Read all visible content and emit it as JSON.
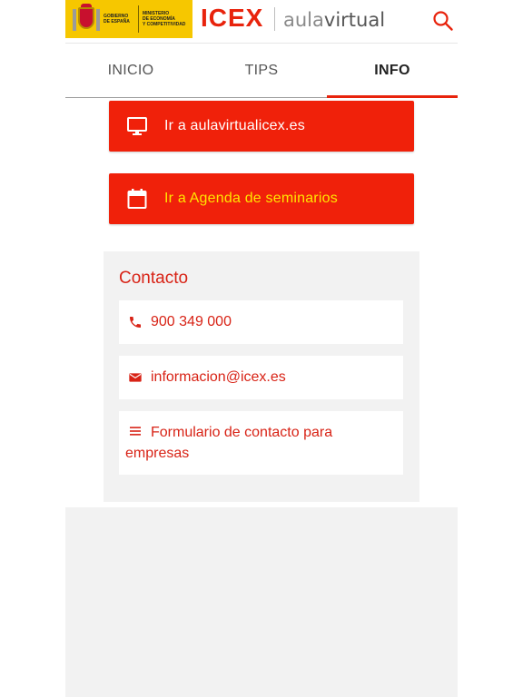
{
  "header": {
    "gov_line1": "GOBIERNO",
    "gov_line2": "DE ESPAÑA",
    "ministry_line1": "MINISTERIO",
    "ministry_line2": "DE ECONOMÍA",
    "ministry_line3": "Y COMPETITIVIDAD",
    "brand": "ICEX",
    "product_light": "aula",
    "product_bold": "virtual",
    "search_icon": "search-icon"
  },
  "tabs": [
    {
      "label": "INICIO",
      "active": false
    },
    {
      "label": "TIPS",
      "active": false
    },
    {
      "label": "INFO",
      "active": true
    }
  ],
  "actions": [
    {
      "label": "Ir a aulavirtualicex.es",
      "icon": "monitor-icon"
    },
    {
      "label": "Ir a Agenda de seminarios",
      "icon": "calendar-icon"
    }
  ],
  "contact": {
    "title": "Contacto",
    "phone": "900 349 000",
    "email": "informacion@icex.es",
    "form": "Formulario de contacto para empresas"
  },
  "colors": {
    "accent": "#e8230c",
    "button": "#f0210a",
    "highlight_text": "#ffe500",
    "card_bg": "#f2f2f2",
    "gov_yellow": "#f6c700"
  }
}
